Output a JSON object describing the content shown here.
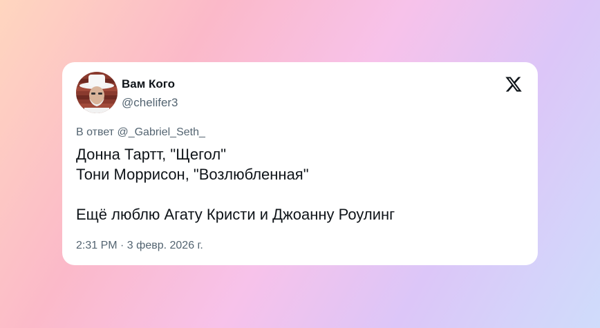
{
  "author": {
    "display_name": "Вам Кого",
    "handle": "@chelifer3"
  },
  "platform": {
    "logo_icon": "x-logo-icon"
  },
  "tweet": {
    "reply_to": "В ответ @_Gabriel_Seth_",
    "lines": [
      "Донна Тартт, \"Щегол\"",
      "Тони Моррисон, \"Возлюбленная\"",
      "",
      "Ещё люблю Агату Кристи и Джоанну Роулинг"
    ],
    "timestamp": "2:31 PM · 3 февр. 2026 г."
  },
  "colors": {
    "text_primary": "#0f1419",
    "text_secondary": "#536471",
    "card_background": "#ffffff"
  }
}
